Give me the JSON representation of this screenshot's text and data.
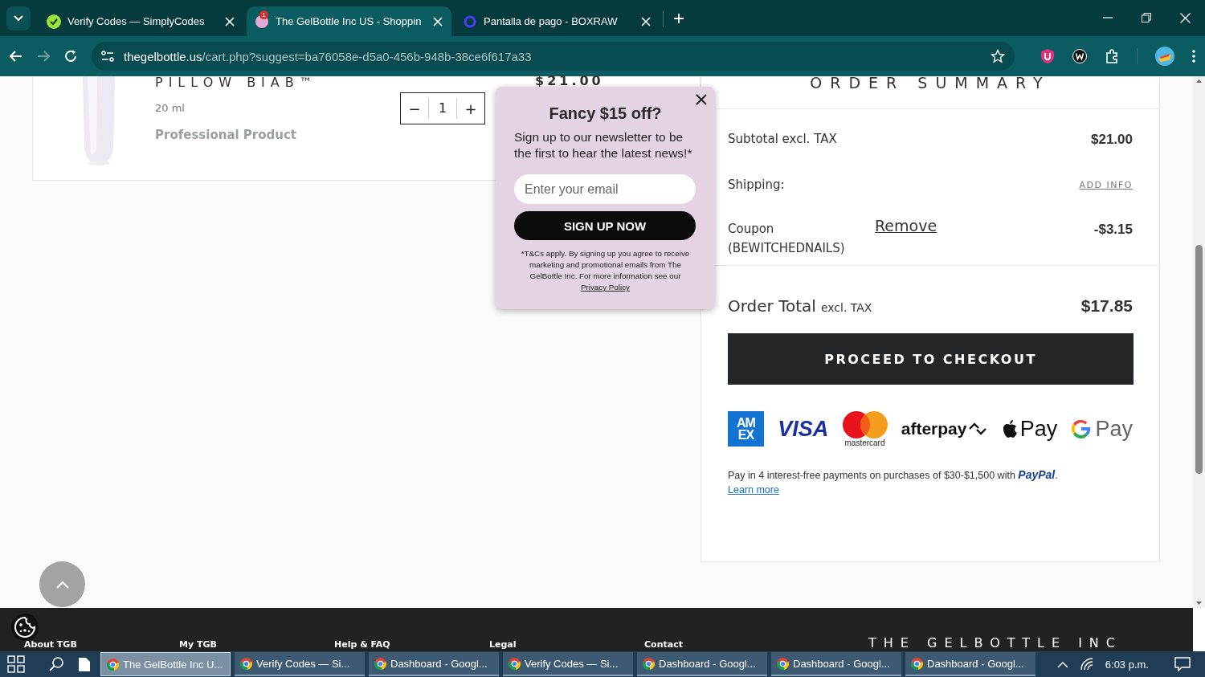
{
  "browser": {
    "tabs": [
      {
        "title": "Verify Codes — SimplyCodes",
        "selected": false,
        "kind": "check"
      },
      {
        "title": "The GelBottle Inc US - Shoppin",
        "selected": true,
        "kind": "dot",
        "badge": "1"
      },
      {
        "title": "Pantalla de pago - BOXRAW",
        "selected": false,
        "kind": "ring"
      }
    ],
    "url_host": "thegelbottle.us",
    "url_path": "/cart.php?suggest=ba76058e-d5a0-456b-948b-38ce6f617a33"
  },
  "cart_item": {
    "name": "PILLOW BIAB™",
    "size": "20 ml",
    "tag": "Professional Product",
    "decrease": "−",
    "quantity": "1",
    "increase": "+",
    "price": "$21.00"
  },
  "summary": {
    "title": "ORDER SUMMARY",
    "rows": [
      {
        "kind": "amount",
        "label": "Subtotal excl. TAX",
        "value": "$21.00"
      },
      {
        "kind": "link",
        "label": "Shipping:",
        "link": "ADD INFO"
      },
      {
        "kind": "coupon",
        "label": "Coupon",
        "code": "(BEWITCHEDNAILS)",
        "action": "Remove",
        "value": "-$3.15"
      }
    ],
    "total_label": "Order Total",
    "total_note": "excl. TAX",
    "total": "$17.85",
    "checkout": "PROCEED TO CHECKOUT",
    "payment_methods": [
      {
        "kind": "amex",
        "lines": [
          "AM",
          "EX"
        ]
      },
      {
        "kind": "visa",
        "text": "VISA"
      },
      {
        "kind": "mastercard",
        "text": "mastercard"
      },
      {
        "kind": "afterpay",
        "text": "afterpay"
      },
      {
        "kind": "applepay",
        "text": "Pay"
      },
      {
        "kind": "googlepay",
        "text": "Pay"
      }
    ],
    "paypal_note": "Pay in 4 interest-free payments on purchases of $30-$1,500 with **PayPal**.",
    "learn_more": "Learn more"
  },
  "popup": {
    "title": "Fancy $15 off?",
    "text": "Sign up to our newsletter to be the first to hear the latest news!*",
    "placeholder": "Enter your email",
    "button": "SIGN UP NOW",
    "legal": "*T&Cs apply. By signing up you agree to receive marketing and promotional emails from The GelBottle Inc. For more information see our",
    "link": "Privacy Policy"
  },
  "footer": {
    "headings": [
      "About TGB",
      "My TGB",
      "Help & FAQ",
      "Legal",
      "Contact"
    ],
    "brand": "THE GELBOTTLE INC"
  },
  "taskbar": {
    "items": [
      {
        "title": "The GelBottle Inc U...",
        "selected": true
      },
      {
        "title": "Verify Codes — Si...",
        "selected": false
      },
      {
        "title": "Dashboard - Googl...",
        "selected": false
      },
      {
        "title": "Verify Codes — Si...",
        "selected": false
      },
      {
        "title": "Dashboard - Googl...",
        "selected": false
      },
      {
        "title": "Dashboard - Googl...",
        "selected": false
      },
      {
        "title": "Dashboard - Googl...",
        "selected": false
      }
    ],
    "clock": "6:03 p.m."
  }
}
